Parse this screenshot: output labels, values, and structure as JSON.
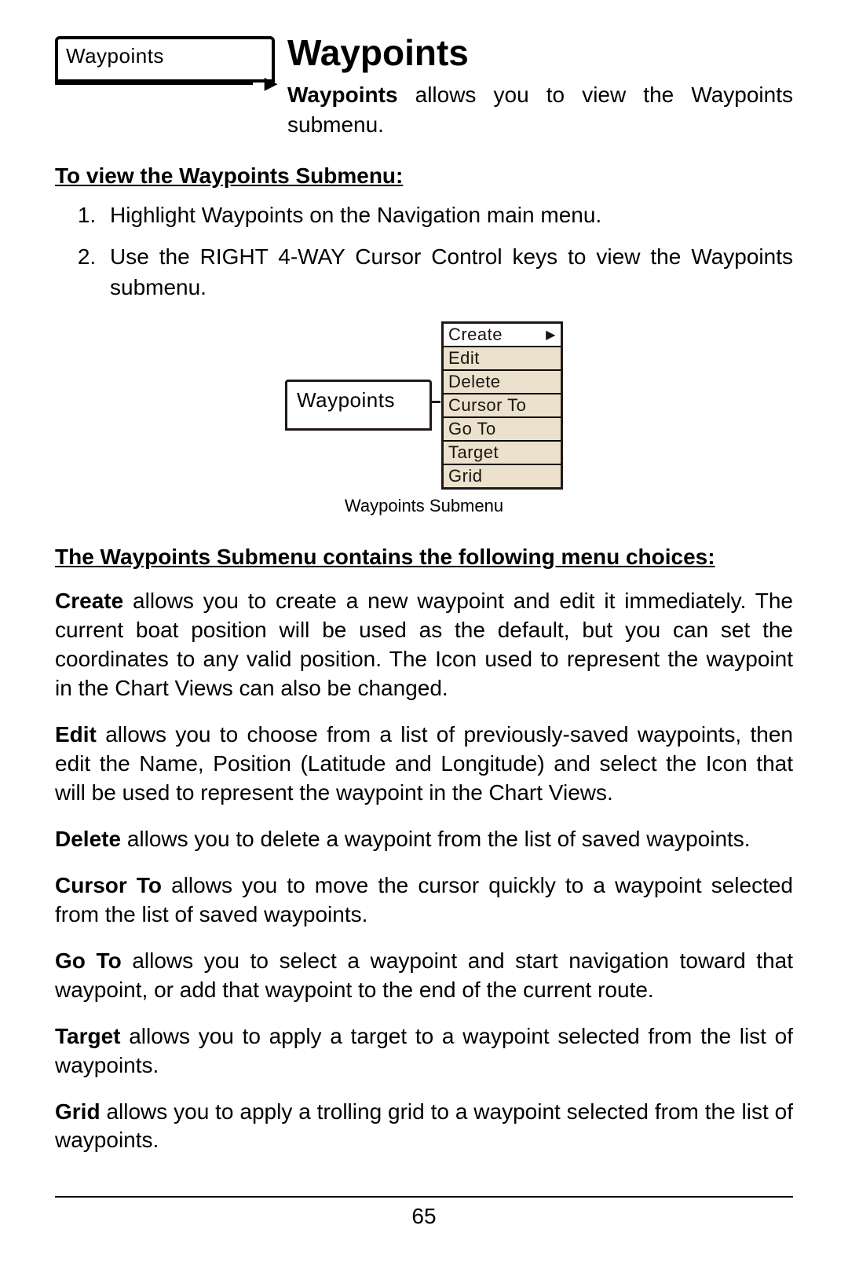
{
  "header": {
    "menu_box_label": "Waypoints",
    "title": "Waypoints",
    "lead_bold": "Waypoints",
    "lead_rest": " allows you to view the Waypoints submenu."
  },
  "view_submenu_head": "To view the Waypoints Submenu:",
  "steps": [
    "Highlight Waypoints on the Navigation main menu.",
    "Use the RIGHT 4-WAY Cursor Control keys to view the Waypoints submenu."
  ],
  "figure": {
    "parent_label": "Waypoints",
    "items": [
      {
        "label": "Create",
        "selected": true
      },
      {
        "label": "Edit"
      },
      {
        "label": "Delete"
      },
      {
        "label": "Cursor To"
      },
      {
        "label": "Go To"
      },
      {
        "label": "Target"
      },
      {
        "label": "Grid"
      }
    ],
    "caption": "Waypoints Submenu"
  },
  "choices_head": "The Waypoints Submenu contains the following menu choices:",
  "descs": [
    {
      "bold": "Create",
      "rest": " allows you to create a new waypoint and edit it immediately. The current boat position will be used as the default, but you can set the coordinates to any valid position. The Icon used to represent the waypoint in the Chart Views can also be changed."
    },
    {
      "bold": "Edit",
      "rest": " allows you to choose from a list of previously-saved waypoints, then edit the Name, Position (Latitude and Longitude) and select the Icon that will be used to represent the waypoint in the Chart Views."
    },
    {
      "bold": "Delete",
      "rest": " allows you to delete a waypoint from the list of saved waypoints."
    },
    {
      "bold": "Cursor To",
      "rest": " allows you to move the cursor quickly to a waypoint selected from the list of saved waypoints."
    },
    {
      "bold": "Go To",
      "rest": " allows you to select a waypoint and start navigation toward that waypoint, or add that waypoint to the end of the current route."
    },
    {
      "bold": "Target",
      "rest": " allows you to apply a target to a waypoint selected from the list of waypoints."
    },
    {
      "bold": "Grid",
      "rest": " allows you to apply a trolling grid to a waypoint selected from the list of waypoints."
    }
  ],
  "page_number": "65"
}
